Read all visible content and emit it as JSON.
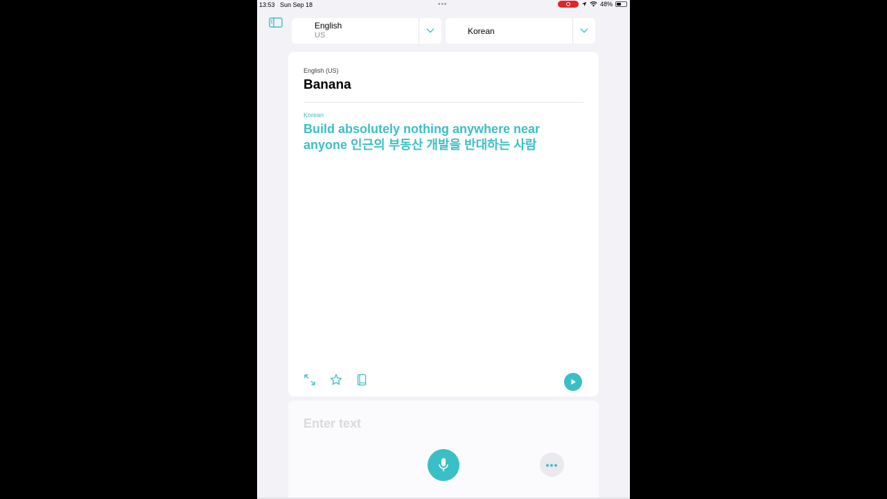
{
  "status_bar": {
    "time": "13:53",
    "date": "Sun Sep 18",
    "multitask_dots": "•••",
    "battery": "48%",
    "battery_level": 0.48,
    "recording_color": "#e0242a"
  },
  "language_bar": {
    "source": {
      "name": "English",
      "region": "US"
    },
    "target": {
      "name": "Korean"
    }
  },
  "translation": {
    "source_label": "English (US)",
    "source_text": "Banana",
    "target_label": "Korean",
    "target_text": "Build absolutely nothing anywhere near anyone 인근의 부동산 개발을 반대하는 사람"
  },
  "toolbar": {
    "icons": [
      "expand-icon",
      "star-icon",
      "dictionary-icon",
      "play-icon"
    ]
  },
  "input": {
    "placeholder": "Enter text"
  },
  "colors": {
    "accent": "#3bbfc6",
    "background": "#f2f2f7",
    "card": "#ffffff"
  }
}
